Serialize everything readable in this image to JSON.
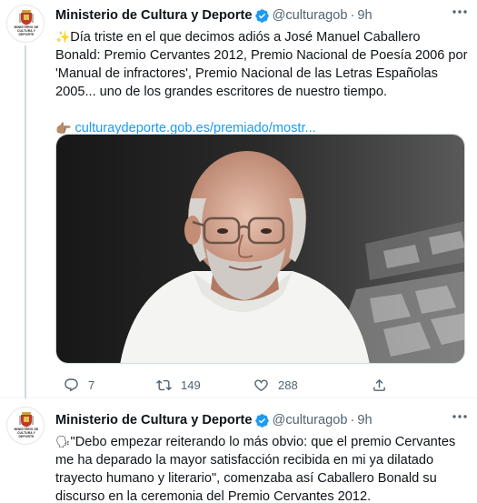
{
  "tweets": [
    {
      "author": {
        "name": "Ministerio de Cultura y Deporte",
        "handle": "@culturagob",
        "avatar_text": "MINISTERIO DE CULTURA Y DEPORTE"
      },
      "separator": "·",
      "time": "9h",
      "emoji": "✨",
      "text": "Día triste en el que decimos adiós a José Manuel Caballero Bonald: Premio Cervantes 2012, Premio Nacional de Poesía 2006 por 'Manual de infractores', Premio Nacional de las Letras Españolas 2005... uno de los grandes escritores de nuestro tiempo.",
      "link": {
        "emoji": "👉🏽",
        "text": "culturaydeporte.gob.es/premiado/mostr..."
      },
      "stats": {
        "replies": "7",
        "retweets": "149",
        "likes": "288"
      }
    },
    {
      "author": {
        "name": "Ministerio de Cultura y Deporte",
        "handle": "@culturagob",
        "avatar_text": "MINISTERIO DE CULTURA Y DEPORTE"
      },
      "separator": "·",
      "time": "9h",
      "emoji": "🗣",
      "text": "\"Debo empezar reiterando lo más obvio: que el premio Cervantes me ha deparado la mayor satisfacción recibida en mi ya dilatado trayecto humano y literario\", comenzaba así Caballero Bonald su discurso en la ceremonia del Premio Cervantes 2012."
    }
  ],
  "colors": {
    "accent": "#1d9bf0",
    "secondary_text": "#536471",
    "primary_text": "#0f1419"
  }
}
